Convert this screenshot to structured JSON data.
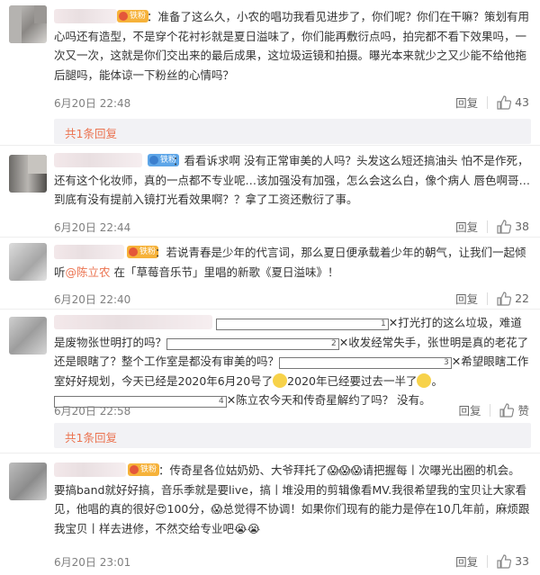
{
  "comments": [
    {
      "badge": "铁粉",
      "text": "：准备了这么久，小农的唱功我看见进步了，你们呢？你们在干嘛？策划有用心吗还有造型，不是穿个花衬衫就是夏日溢味了，你们能再敷衍点吗，拍完都不看下效果吗，一次又一次，这就是你们交出来的最后成果，这垃圾运镜和拍摄。曝光本来就少之又少能不给他拖后腿吗，能体谅一下粉丝的心情吗？",
      "time": "6月20日 22:48",
      "reply": "回复",
      "likes": "43",
      "reply_summary": "共1条回复"
    },
    {
      "badge": "铁粉",
      "text": "：看看诉求啊 没有正常审美的人吗？头发这么短还搞油头 怕不是作死，还有这个化妆师，真的一点都不专业呢…该加强没有加强，怎么会这么白，像个病人 唇色啊哥… 到底有没有提前入镜打光看效果啊？？拿了工资还敷衍了事。",
      "time": "6月20日 22:44",
      "reply": "回复",
      "likes": "38"
    },
    {
      "badge": "铁粉",
      "text_part1": "：若说青春是少年的代言词，那么夏日便承载着少年的朝气，让我们一起倾听",
      "mention": "@陈立农",
      "text_part2": " 在「草莓音乐节」里唱的新歌《夏日溢味》！",
      "time": "6月20日 22:40",
      "reply": "回复",
      "likes": "22"
    },
    {
      "n1": "1",
      "n2": "2",
      "n3": "3",
      "n4": "4",
      "seg1": "✕打光打的这么垃圾，难道是废物张世明打的吗？",
      "seg2": "✕收发经常失手，张世明是真的老花了还是眼瞎了？整个工作室是都没有审美的吗？",
      "seg3": "✕希望眼瞎工作室好好规划，今天已经是2020年6月20号了",
      "seg4": "2020年已经要过去一半了",
      "seg5": "✕陈立农今天和传奇星解约了吗？ 没有。",
      "time": "6月20日 22:58",
      "reply": "回复",
      "likes": "赞",
      "reply_summary": "共1条回复"
    },
    {
      "badge": "铁粉",
      "text": "：传奇星各位姑奶奶、大爷拜托了😱😱😱请把握每丨次曝光出圈的机会。要搞band就好好搞，音乐季就是要live，搞丨堆没用的剪辑像看MV.我很希望我的宝贝让大家看见，他唱的真的很好😍100分，😱总觉得不协调！如果你们现有的能力是停在10几年前，麻烦跟我宝贝丨样去进修，不然交给专业吧😭😭",
      "time": "6月20日 23:01",
      "reply": "回复",
      "likes": "33"
    }
  ],
  "colors": {
    "link": "#eb7350",
    "badge_gold": "#f6b23a",
    "badge_blue": "#5ea6e8"
  },
  "icons": {
    "like": "thumbs-up-icon"
  }
}
